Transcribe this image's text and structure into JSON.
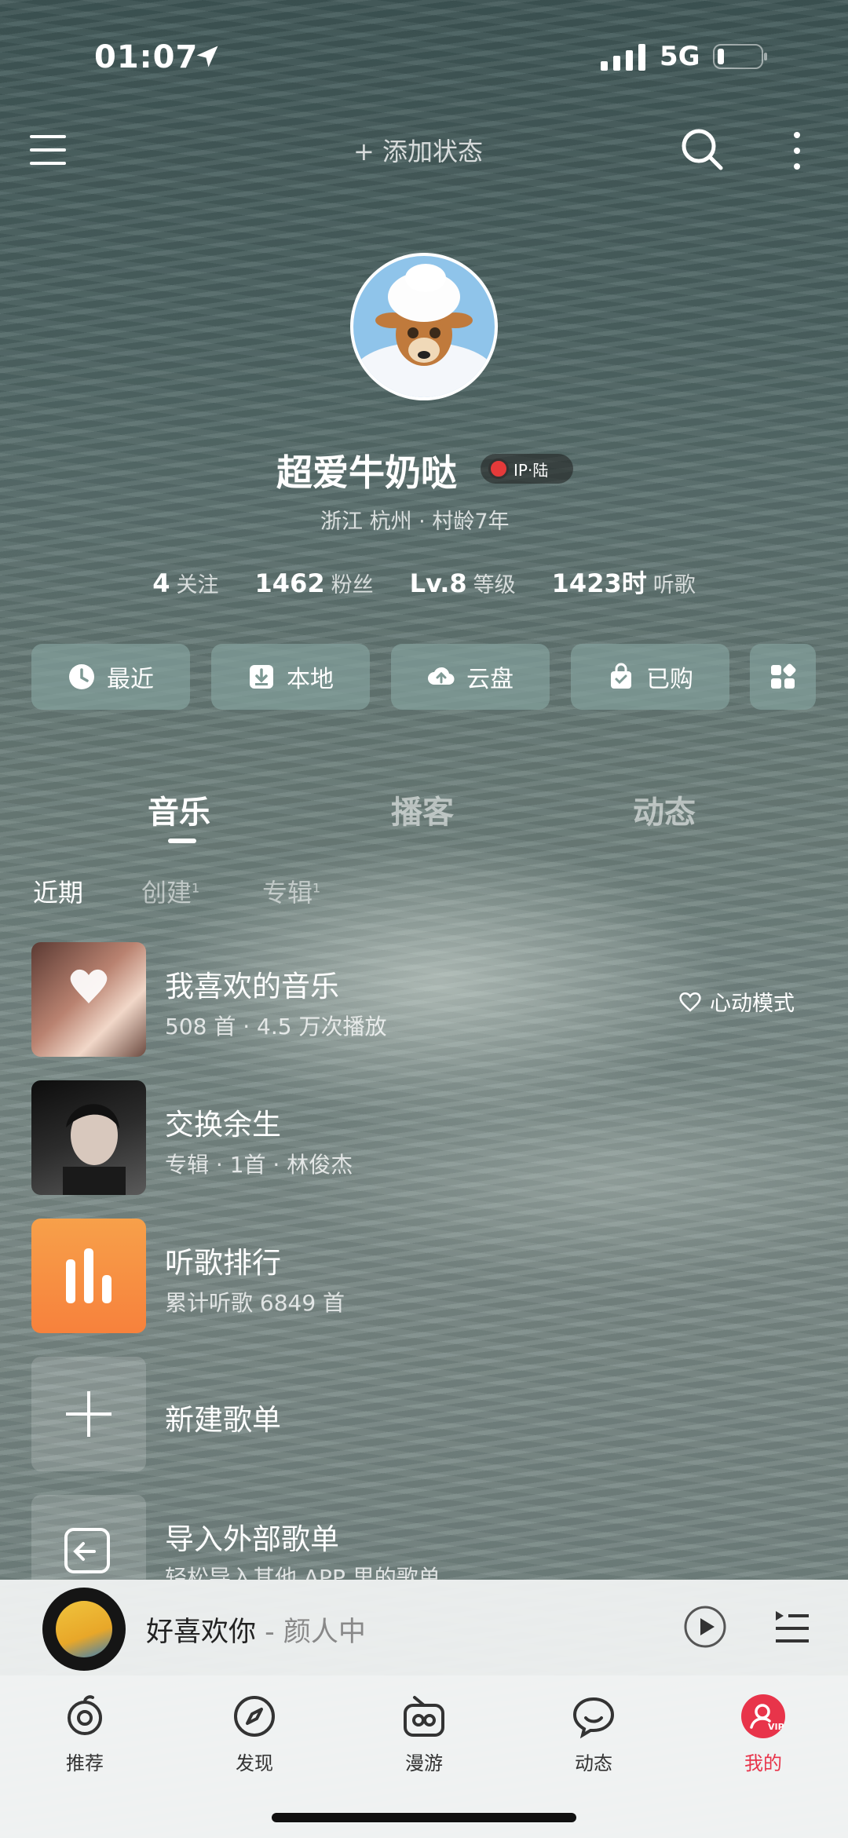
{
  "status_bar": {
    "time": "01:07",
    "network": "5G"
  },
  "header": {
    "add_status": "+ 添加状态"
  },
  "profile": {
    "username": "超爱牛奶哒",
    "ip_badge": "IP·陆",
    "location": "浙江 杭州 · 村龄7年",
    "stats": [
      {
        "num": "4",
        "label": "关注"
      },
      {
        "num": "1462",
        "label": "粉丝"
      },
      {
        "num": "Lv.8",
        "label": "等级"
      },
      {
        "num": "1423时",
        "label": "听歌"
      }
    ]
  },
  "quick_buttons": [
    {
      "label": "最近",
      "icon": "clock-icon"
    },
    {
      "label": "本地",
      "icon": "download-icon"
    },
    {
      "label": "云盘",
      "icon": "cloud-upload-icon"
    },
    {
      "label": "已购",
      "icon": "shopping-bag-icon"
    }
  ],
  "tabs": [
    "音乐",
    "播客",
    "动态"
  ],
  "subtabs": [
    {
      "label": "近期",
      "count": ""
    },
    {
      "label": "创建",
      "count": "1"
    },
    {
      "label": "专辑",
      "count": "1"
    }
  ],
  "list": [
    {
      "title": "我喜欢的音乐",
      "sub": "508 首 · 4.5 万次播放",
      "action": "心动模式"
    },
    {
      "title": "交换余生",
      "sub": "专辑 · 1首 · 林俊杰"
    },
    {
      "title": "听歌排行",
      "sub": "累计听歌 6849 首"
    },
    {
      "title": "新建歌单",
      "sub": ""
    },
    {
      "title": "导入外部歌单",
      "sub": "轻松导入其他 APP 里的歌单"
    }
  ],
  "player": {
    "song": "好喜欢你",
    "artist": " - 颜人中"
  },
  "nav": [
    {
      "label": "推荐",
      "icon": "recommend-icon"
    },
    {
      "label": "发现",
      "icon": "compass-icon"
    },
    {
      "label": "漫游",
      "icon": "radio-icon"
    },
    {
      "label": "动态",
      "icon": "chat-icon"
    },
    {
      "label": "我的",
      "icon": "user-vip-icon"
    }
  ],
  "colors": {
    "accent": "#e8344a",
    "playlist_orange": "#f7913f"
  }
}
